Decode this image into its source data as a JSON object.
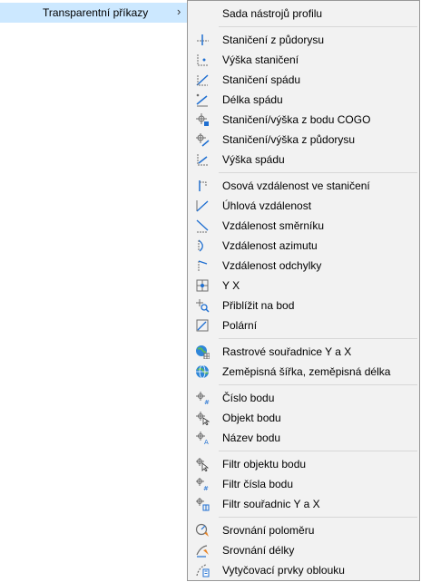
{
  "parent": {
    "label": "Transparentní příkazy",
    "chevron": "›"
  },
  "items": [
    {
      "label": "Sada nástrojů profilu",
      "icon": "blank"
    },
    {
      "label": "Staničení z půdorysu",
      "icon": "station-plan-icon"
    },
    {
      "label": "Výška staničení",
      "icon": "station-elevation-icon"
    },
    {
      "label": "Staničení spádu",
      "icon": "station-grade-icon"
    },
    {
      "label": "Délka spádu",
      "icon": "grade-length-icon"
    },
    {
      "label": "Staničení/výška z bodu COGO",
      "icon": "station-elevation-cogo-icon"
    },
    {
      "label": "Staničení/výška z půdorysu",
      "icon": "station-elevation-plan-icon"
    },
    {
      "label": "Výška spádu",
      "icon": "grade-elevation-icon"
    },
    {
      "label": "Osová vzdálenost ve staničení",
      "icon": "station-offset-icon"
    },
    {
      "label": "Úhlová vzdálenost",
      "icon": "angle-distance-icon"
    },
    {
      "label": "Vzdálenost směrníku",
      "icon": "bearing-distance-icon"
    },
    {
      "label": "Vzdálenost azimutu",
      "icon": "azimuth-distance-icon"
    },
    {
      "label": "Vzdálenost odchylky",
      "icon": "deflection-distance-icon"
    },
    {
      "label": "Y X",
      "icon": "northing-easting-icon"
    },
    {
      "label": "Přiblížit na bod",
      "icon": "zoom-to-point-icon"
    },
    {
      "label": "Polární",
      "icon": "polar-icon"
    },
    {
      "label": "Rastrové souřadnice Y a X",
      "icon": "grid-globe-icon"
    },
    {
      "label": "Zeměpisná šířka, zeměpisná délka",
      "icon": "latlong-globe-icon"
    },
    {
      "label": "Číslo bodu",
      "icon": "point-number-icon"
    },
    {
      "label": "Objekt bodu",
      "icon": "point-object-icon"
    },
    {
      "label": "Název bodu",
      "icon": "point-name-icon"
    },
    {
      "label": "Filtr objektu bodu",
      "icon": "point-object-filter-icon"
    },
    {
      "label": "Filtr čísla bodu",
      "icon": "point-number-filter-icon"
    },
    {
      "label": "Filtr souřadnic Y a X",
      "icon": "northing-easting-filter-icon"
    },
    {
      "label": "Srovnání poloměru",
      "icon": "match-radius-icon"
    },
    {
      "label": "Srovnání délky",
      "icon": "match-length-icon"
    },
    {
      "label": "Vytyčovací prvky oblouku",
      "icon": "curve-calculator-icon"
    }
  ],
  "colors": {
    "accent_blue": "#1f6fd1",
    "grey": "#6e6e6e",
    "orange": "#e8862a",
    "highlight": "#cce8ff"
  }
}
